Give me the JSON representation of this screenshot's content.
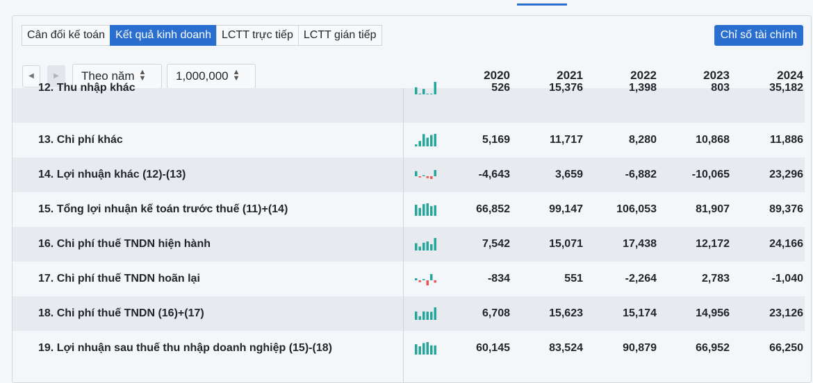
{
  "tabs": [
    {
      "label": "Cân đối kế toán",
      "active": false
    },
    {
      "label": "Kết quả kinh doanh",
      "active": true
    },
    {
      "label": "LCTT trực tiếp",
      "active": false
    },
    {
      "label": "LCTT gián tiếp",
      "active": false
    }
  ],
  "ratio_button": "Chỉ số tài chính",
  "period_select": "Theo năm",
  "unit_select": "1,000,000",
  "years": [
    "2020",
    "2021",
    "2022",
    "2023",
    "2024"
  ],
  "colors": {
    "accent": "#2a6fd0",
    "positive": "#26a69a",
    "negative": "#ef5350"
  },
  "rows": [
    {
      "label": "12. Thu nhập khác",
      "values": [
        "526",
        "15,376",
        "1,398",
        "803",
        "35,182"
      ],
      "spark": [
        20000,
        526,
        15376,
        1398,
        803,
        35182
      ]
    },
    {
      "label": "13. Chi phí khác",
      "values": [
        "5,169",
        "11,717",
        "8,280",
        "10,868",
        "11,886"
      ],
      "spark": [
        1900,
        5169,
        11717,
        8280,
        10868,
        11886
      ]
    },
    {
      "label": "14. Lợi nhuận khác (12)-(13)",
      "values": [
        "-4,643",
        "3,659",
        "-6,882",
        "-10,065",
        "23,296"
      ],
      "spark": [
        19000,
        -4643,
        3659,
        -6882,
        -10065,
        23296
      ]
    },
    {
      "label": "15. Tổng lợi nhuận kế toán trước thuế (11)+(14)",
      "values": [
        "66,852",
        "99,147",
        "106,053",
        "81,907",
        "89,376"
      ],
      "spark": [
        94000,
        66852,
        99147,
        106053,
        81907,
        89376
      ]
    },
    {
      "label": "16. Chi phí thuế TNDN hiện hành",
      "values": [
        "7,542",
        "15,071",
        "17,438",
        "12,172",
        "24,166"
      ],
      "spark": [
        14000,
        7542,
        15071,
        17438,
        12172,
        24166
      ]
    },
    {
      "label": "17. Chi phí thuế TNDN hoãn lại",
      "values": [
        "-834",
        "551",
        "-2,264",
        "2,783",
        "-1,040"
      ],
      "spark": [
        900,
        -834,
        551,
        -2264,
        2783,
        -1040
      ]
    },
    {
      "label": "18. Chi phí thuế TNDN (16)+(17)",
      "values": [
        "6,708",
        "15,623",
        "15,174",
        "14,956",
        "23,126"
      ],
      "spark": [
        15400,
        6708,
        15623,
        15174,
        14956,
        23126
      ]
    },
    {
      "label": "19. Lợi nhuận sau thuế thu nhập doanh nghiệp (15)-(18)",
      "values": [
        "60,145",
        "83,524",
        "90,879",
        "66,952",
        "66,250"
      ],
      "spark": [
        75000,
        60145,
        83524,
        90879,
        66952,
        66250
      ]
    }
  ]
}
